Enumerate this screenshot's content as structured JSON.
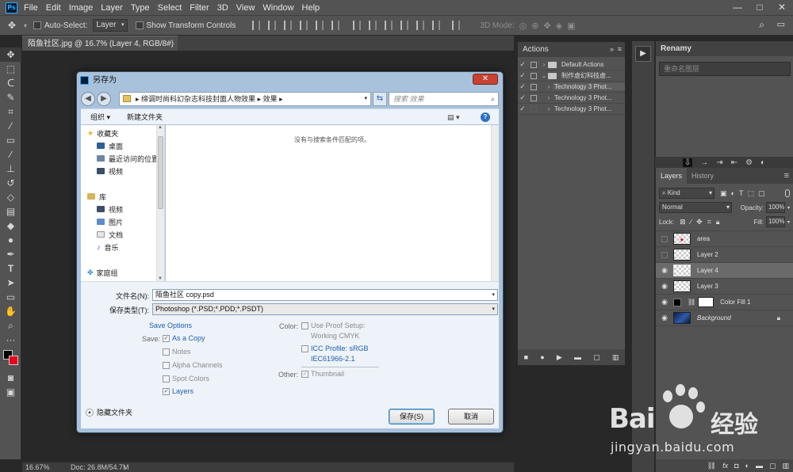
{
  "app": {
    "logo_text": "Ps",
    "menu": [
      "File",
      "Edit",
      "Image",
      "Layer",
      "Type",
      "Select",
      "Filter",
      "3D",
      "View",
      "Window",
      "Help"
    ],
    "window_controls": [
      "—",
      "□",
      "✕"
    ]
  },
  "options": {
    "auto_select_label": "Auto-Select:",
    "auto_select_value": "Layer",
    "show_transform_label": "Show Transform Controls",
    "mode_3d_label": "3D Mode:"
  },
  "document": {
    "tab_title": "陌鱼社区.jpg @ 16.7% (Layer 4, RGB/8#) *",
    "zoom": "16.67%",
    "doc_size": "Doc: 26.8M/54.7M"
  },
  "actions": {
    "title": "Actions",
    "rows": [
      {
        "label": "Default Actions",
        "type": "set"
      },
      {
        "label": "制作虚幻科技虚...",
        "type": "set"
      },
      {
        "label": "Technology 3 Phot...",
        "type": "action"
      },
      {
        "label": "Technology 3 Phot...",
        "type": "action"
      },
      {
        "label": "Technology 3 Phot...",
        "type": "action"
      }
    ]
  },
  "rename": {
    "title": "Renamy",
    "placeholder": "重命名图层"
  },
  "layers": {
    "tab_layers": "Layers",
    "tab_history": "History",
    "kind_label": "Kind",
    "blend_mode": "Normal",
    "opacity_label": "Opacity:",
    "opacity_value": "100%",
    "lock_label": "Lock:",
    "fill_label": "Fill:",
    "fill_value": "100%",
    "rows": [
      {
        "name": "area",
        "visible": false,
        "selected": false,
        "italic": false
      },
      {
        "name": "Layer 2",
        "visible": false,
        "selected": false,
        "italic": false
      },
      {
        "name": "Layer 4",
        "visible": true,
        "selected": true,
        "italic": false
      },
      {
        "name": "Layer 3",
        "visible": true,
        "selected": false,
        "italic": false
      },
      {
        "name": "Color Fill 1",
        "visible": true,
        "selected": false,
        "italic": false
      },
      {
        "name": "Background",
        "visible": true,
        "selected": false,
        "italic": true
      }
    ]
  },
  "dialog": {
    "title": "另存为",
    "close": "✕",
    "path": [
      "缔调时尚科幻杂志科技封面人物效果",
      "效果"
    ],
    "search_placeholder": "搜索 效果",
    "organize": "组织 ▾",
    "new_folder": "新建文件夹",
    "nav": [
      {
        "label": "收藏夹",
        "kind": "header"
      },
      {
        "label": "桌面",
        "kind": "item"
      },
      {
        "label": "最近访问的位置",
        "kind": "item"
      },
      {
        "label": "视频",
        "kind": "item"
      },
      {
        "label": "库",
        "kind": "header"
      },
      {
        "label": "视频",
        "kind": "item"
      },
      {
        "label": "图片",
        "kind": "item"
      },
      {
        "label": "文档",
        "kind": "item"
      },
      {
        "label": "音乐",
        "kind": "item"
      },
      {
        "label": "家庭组",
        "kind": "header"
      }
    ],
    "empty_message": "没有与搜索条件匹配的项。",
    "filename_label": "文件名(N):",
    "filename_value": "陌鱼社区 copy.psd",
    "filetype_label": "保存类型(T):",
    "filetype_value": "Photoshop (*.PSD;*.PDD;*.PSDT)",
    "save_options": "Save Options",
    "save_label": "Save:",
    "opt_as_copy": "As a Copy",
    "opt_notes": "Notes",
    "opt_alpha": "Alpha Channels",
    "opt_spot": "Spot Colors",
    "opt_layers": "Layers",
    "color_label": "Color:",
    "proof_setup": "Use Proof Setup:",
    "proof_value": "Working CMYK",
    "icc_profile": "ICC Profile:  sRGB",
    "icc_value": "IEC61966-2.1",
    "other_label": "Other:",
    "thumbnail": "Thumbnail",
    "hide_folders": "隐藏文件夹",
    "save_button": "保存(S)",
    "cancel_button": "取消"
  },
  "watermark": {
    "bai": "Bai",
    "du_cn": "经验",
    "url": "jingyan.baidu.com"
  }
}
